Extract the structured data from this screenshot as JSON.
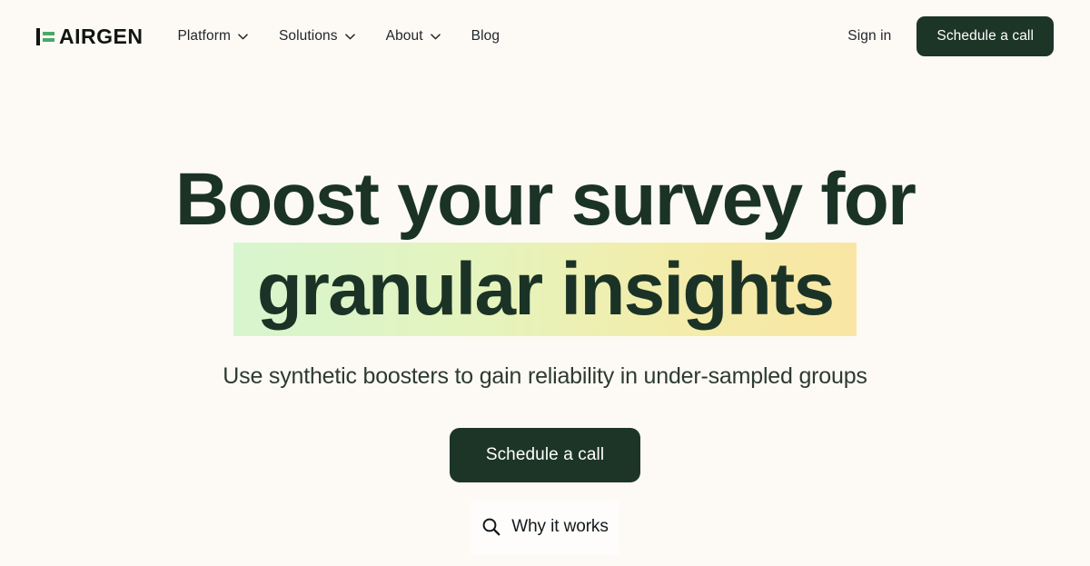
{
  "brand": {
    "name": "AIRGEN",
    "mark_icon": "fairgen-f-mark-icon",
    "accent_green": "#4ba866",
    "mark_dark": "#111511"
  },
  "header": {
    "nav": [
      {
        "label": "Platform",
        "has_dropdown": true,
        "icon": "chevron-down-icon"
      },
      {
        "label": "Solutions",
        "has_dropdown": true,
        "icon": "chevron-down-icon"
      },
      {
        "label": "About",
        "has_dropdown": true,
        "icon": "chevron-down-icon"
      },
      {
        "label": "Blog",
        "has_dropdown": false,
        "icon": ""
      }
    ],
    "signin_label": "Sign in",
    "cta_label": "Schedule a call"
  },
  "hero": {
    "headline_line1": "Boost your survey for",
    "headline_line2": "granular insights",
    "subtitle": "Use synthetic boosters to gain reliability in under-sampled groups",
    "cta_label": "Schedule a call",
    "secondary_label": "Why it works",
    "secondary_icon": "search-icon"
  },
  "colors": {
    "page_background": "#fdfaf5",
    "dark_green": "#1d3527",
    "headline_green": "#1b3326",
    "highlight_gradient_start": "#d7f5cf",
    "highlight_gradient_end": "#f9e6a4",
    "panel_background": "#fefdfb"
  }
}
